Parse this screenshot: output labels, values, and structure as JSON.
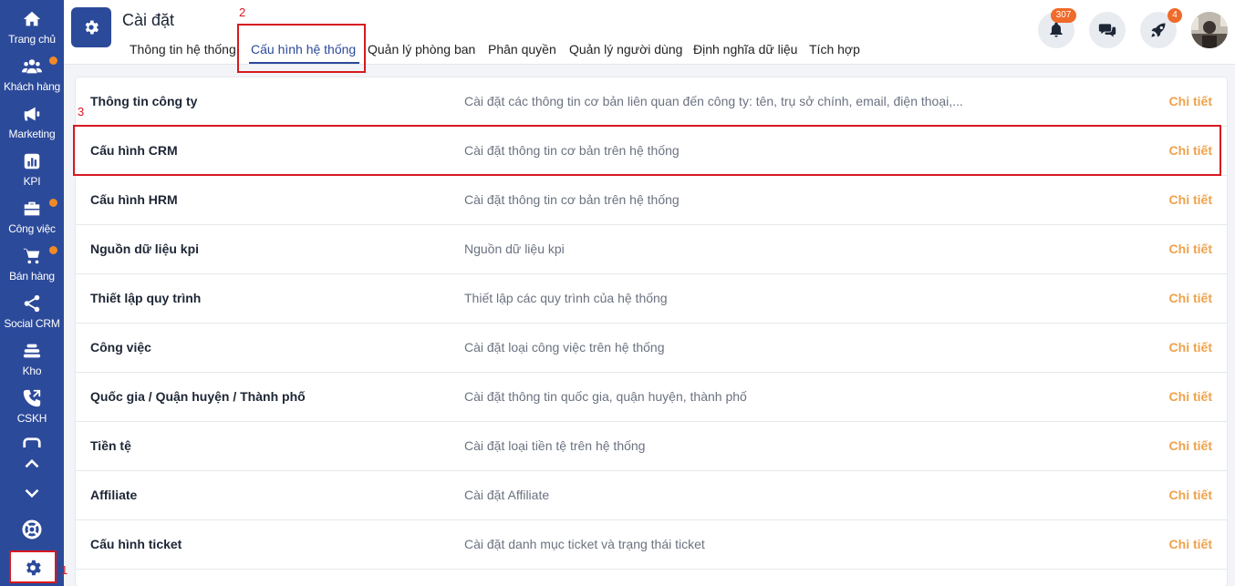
{
  "app": {
    "title": "Cài đặt"
  },
  "sidebar": {
    "items": [
      {
        "label": "Trang chủ",
        "icon": "home-icon"
      },
      {
        "label": "Khách hàng",
        "icon": "users-icon"
      },
      {
        "label": "Marketing",
        "icon": "megaphone-icon"
      },
      {
        "label": "KPI",
        "icon": "bar-chart-icon"
      },
      {
        "label": "Công việc",
        "icon": "briefcase-icon"
      },
      {
        "label": "Bán hàng",
        "icon": "cart-icon"
      },
      {
        "label": "Social CRM",
        "icon": "share-icon"
      },
      {
        "label": "Kho",
        "icon": "warehouse-icon"
      },
      {
        "label": "CSKH",
        "icon": "phone-icon"
      }
    ],
    "scroll_up_icon": "chevron-up-icon",
    "scroll_down_icon": "chevron-down-icon",
    "support_icon": "lifebuoy-icon",
    "settings_icon": "gear-icon"
  },
  "tabs": [
    {
      "label": "Thông tin hệ thống",
      "active": false
    },
    {
      "label": "Cấu hình hệ thống",
      "active": true
    },
    {
      "label": "Quản lý phòng ban",
      "active": false
    },
    {
      "label": "Phân quyền",
      "active": false
    },
    {
      "label": "Quản lý người dùng",
      "active": false
    },
    {
      "label": "Định nghĩa dữ liệu",
      "active": false
    },
    {
      "label": "Tích hợp",
      "active": false
    }
  ],
  "header_actions": {
    "notifications_count": "307",
    "rocket_count": "4"
  },
  "settings_rows": [
    {
      "name": "Thông tin công ty",
      "description": "Cài đặt các thông tin cơ bản liên quan đến công ty: tên, trụ sở chính, email, điện thoại,...",
      "action": "Chi tiết"
    },
    {
      "name": "Cấu hình CRM",
      "description": "Cài đặt thông tin cơ bản trên hệ thống",
      "action": "Chi tiết"
    },
    {
      "name": "Cấu hình HRM",
      "description": "Cài đặt thông tin cơ bản trên hệ thống",
      "action": "Chi tiết"
    },
    {
      "name": "Nguồn dữ liệu kpi",
      "description": "Nguồn dữ liệu kpi",
      "action": "Chi tiết"
    },
    {
      "name": "Thiết lập quy trình",
      "description": "Thiết lập các quy trình của hệ thống",
      "action": "Chi tiết"
    },
    {
      "name": "Công việc",
      "description": "Cài đặt loại công việc trên hệ thống",
      "action": "Chi tiết"
    },
    {
      "name": "Quốc gia / Quận huyện / Thành phố",
      "description": "Cài đặt thông tin quốc gia, quận huyện, thành phố",
      "action": "Chi tiết"
    },
    {
      "name": "Tiền tệ",
      "description": "Cài đặt loại tiền tệ trên hệ thống",
      "action": "Chi tiết"
    },
    {
      "name": "Affiliate",
      "description": "Cài đặt Affiliate",
      "action": "Chi tiết"
    },
    {
      "name": "Cấu hình ticket",
      "description": "Cài đặt danh mục ticket và trạng thái ticket",
      "action": "Chi tiết"
    }
  ],
  "annotations": {
    "step1": "1",
    "step2": "2",
    "step3": "3"
  },
  "colors": {
    "sidebar": "#2c4a9a",
    "accent": "#f0a24a",
    "highlight": "#d71920",
    "badge": "#f06a2a"
  }
}
